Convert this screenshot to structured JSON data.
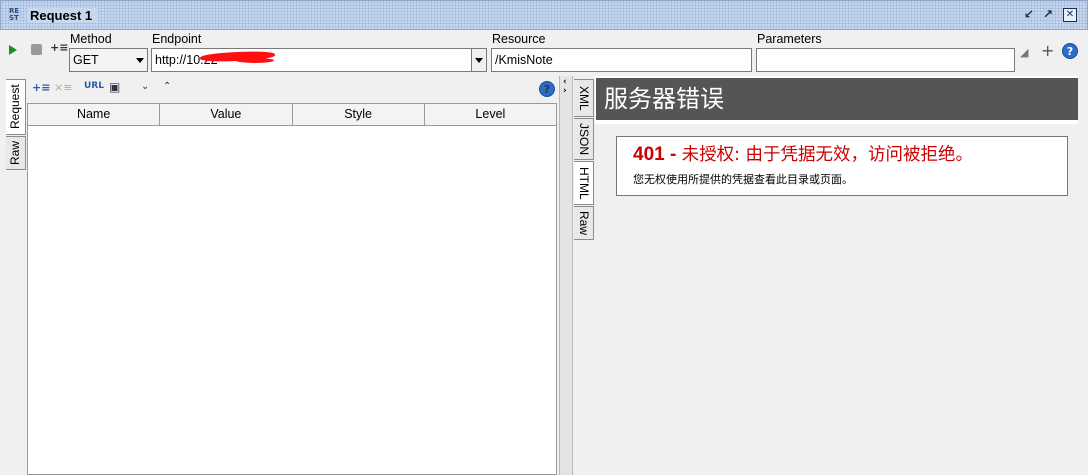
{
  "window": {
    "icon_text": "RE\nST",
    "title": "Request 1"
  },
  "toolbar": {
    "method_label": "Method",
    "method_value": "GET",
    "endpoint_label": "Endpoint",
    "endpoint_value": "http://10.22",
    "resource_label": "Resource",
    "resource_value": "/KmisNote",
    "parameters_label": "Parameters",
    "parameters_value": ""
  },
  "request_tabs": [
    "Request",
    "Raw"
  ],
  "params_table": {
    "columns": [
      "Name",
      "Value",
      "Style",
      "Level"
    ]
  },
  "response_tabs": [
    "XML",
    "JSON",
    "HTML",
    "Raw"
  ],
  "response": {
    "header": "服务器错误",
    "error_code": "401 - ",
    "error_title": "未授权: 由于凭据无效，访问被拒绝。",
    "error_message": "您无权使用所提供的凭据查看此目录或页面。"
  },
  "colors": {
    "title_bar": "#c7d7ee",
    "error_header_bg": "#555555",
    "error_text": "#cc0000",
    "play_green": "#1a8f1a"
  }
}
